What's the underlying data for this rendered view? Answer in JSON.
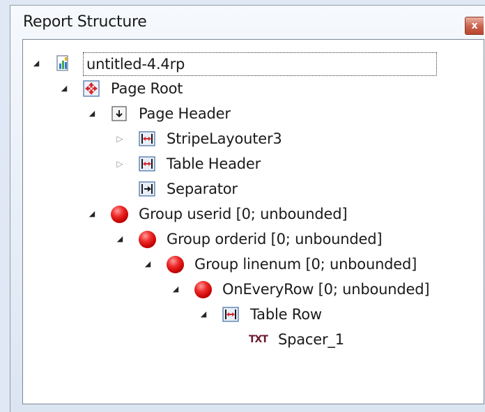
{
  "panel": {
    "title": "Report Structure",
    "close_glyph": "x"
  },
  "tree": {
    "nodes": [
      {
        "label": "untitled-4.4rp",
        "icon": "report-file-icon",
        "expander": "expanded",
        "depth": 0
      },
      {
        "label": "Page Root",
        "icon": "page-root-icon",
        "expander": "expanded",
        "depth": 1
      },
      {
        "label": "Page Header",
        "icon": "page-header-icon",
        "expander": "expanded",
        "depth": 2
      },
      {
        "label": "StripeLayouter3",
        "icon": "band-icon",
        "expander": "collapsed",
        "depth": 3
      },
      {
        "label": "Table Header",
        "icon": "band-icon",
        "expander": "collapsed",
        "depth": 3
      },
      {
        "label": "Separator",
        "icon": "separator-icon",
        "expander": "none",
        "depth": 3
      },
      {
        "label": "Group userid [0; unbounded]",
        "icon": "group-icon",
        "expander": "expanded",
        "depth": 2
      },
      {
        "label": "Group orderid [0; unbounded]",
        "icon": "group-icon",
        "expander": "expanded",
        "depth": 3
      },
      {
        "label": "Group linenum [0; unbounded]",
        "icon": "group-icon",
        "expander": "expanded",
        "depth": 4
      },
      {
        "label": "OnEveryRow [0; unbounded]",
        "icon": "group-icon",
        "expander": "expanded",
        "depth": 5
      },
      {
        "label": "Table Row",
        "icon": "band-icon",
        "expander": "expanded",
        "depth": 6
      },
      {
        "label": "Spacer_1",
        "icon": "text-field-icon",
        "icon_text": "TXT",
        "expander": "none",
        "depth": 7
      }
    ]
  },
  "colors": {
    "band_icon_border": "#5a7fb0",
    "arrow_red": "#d8262b",
    "group_red": "#d40000",
    "txt_icon": "#6b1a2d"
  }
}
